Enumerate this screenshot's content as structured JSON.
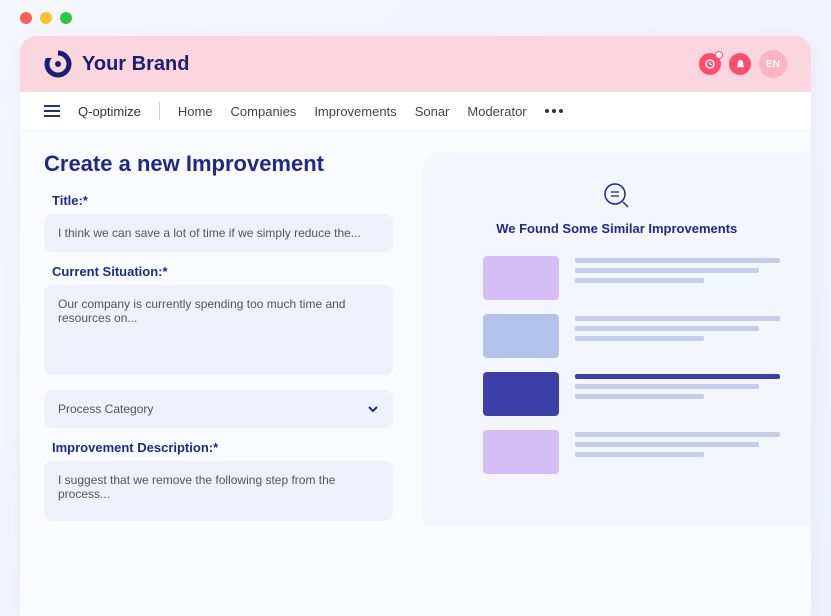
{
  "brand": {
    "name": "Your Brand"
  },
  "lang": "EN",
  "nav": {
    "app_name": "Q-optimize",
    "links": [
      "Home",
      "Companies",
      "Improvements",
      "Sonar",
      "Moderator"
    ]
  },
  "page": {
    "title": "Create a new Improvement",
    "labels": {
      "title": "Title:*",
      "current_situation": "Current Situation:*",
      "improvement_description": "Improvement Description:*"
    },
    "values": {
      "title": "I think we can save a lot of time if we simply reduce the...",
      "current_situation": "Our company is currently spending too much time and resources on...",
      "improvement_description": "I suggest that we remove the following step from the process..."
    },
    "category_placeholder": "Process Category"
  },
  "sidebar": {
    "title": "We Found Some Similar Improvements"
  }
}
